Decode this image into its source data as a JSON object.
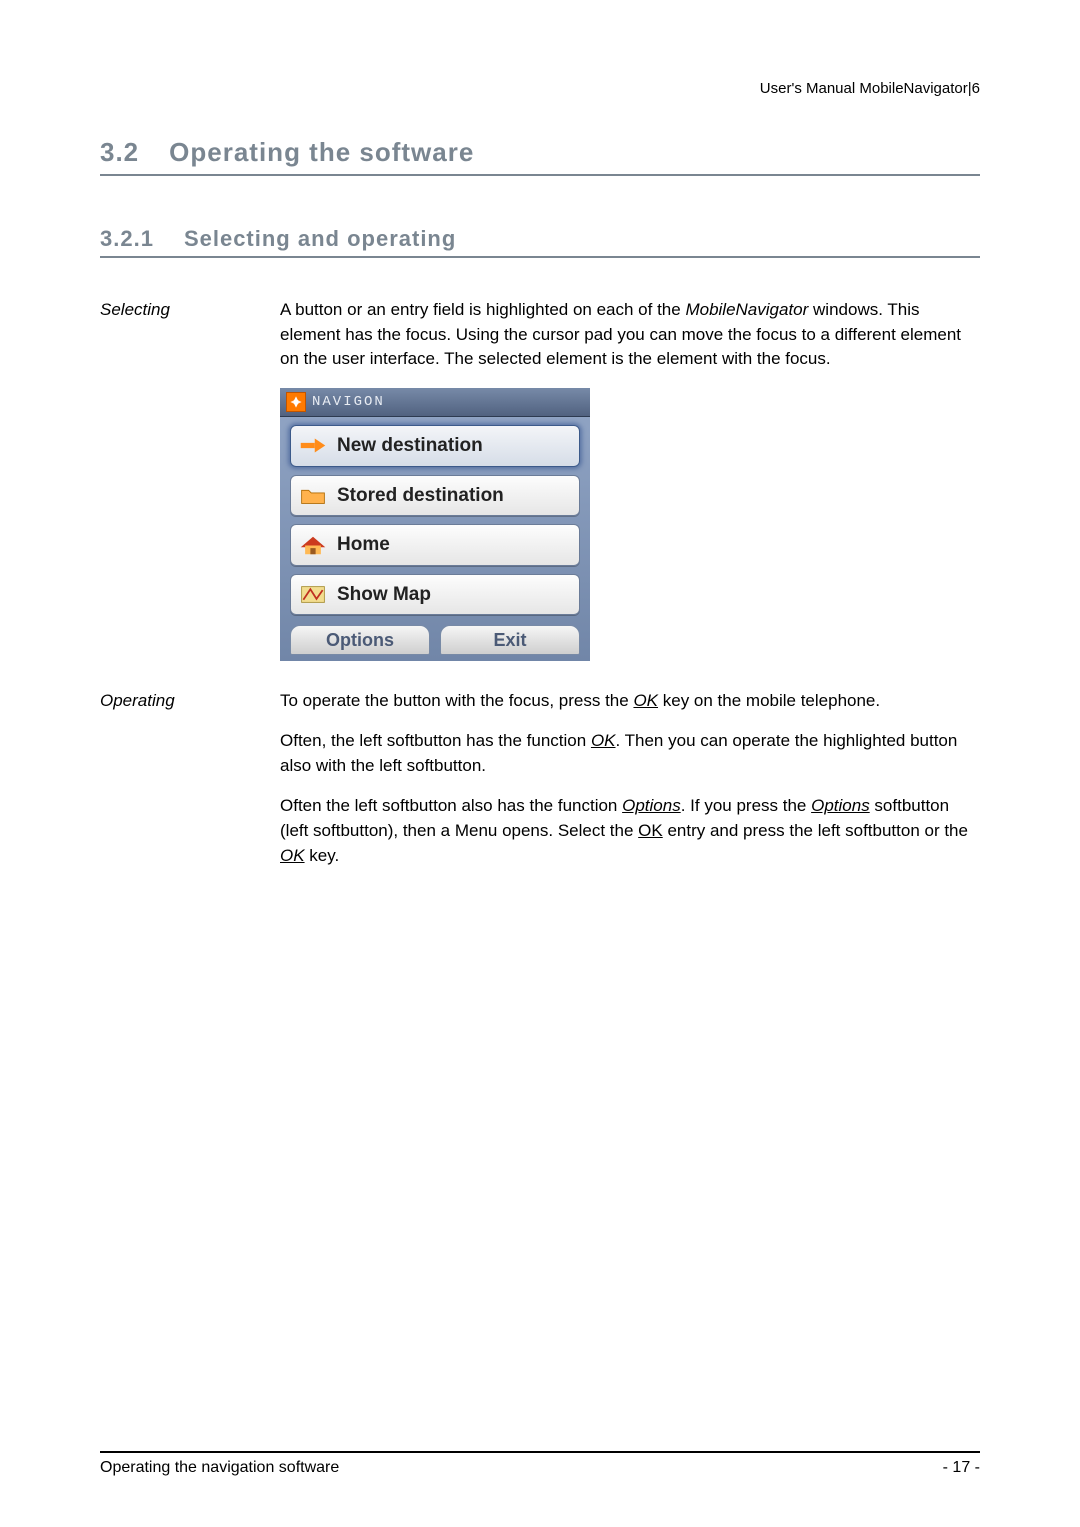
{
  "header": {
    "top_right": "User's Manual MobileNavigator|6"
  },
  "headings": {
    "h1_num": "3.2",
    "h1_title": "Operating the software",
    "h2_num": "3.2.1",
    "h2_title": "Selecting and operating"
  },
  "sidebar": {
    "selecting": "Selecting",
    "operating": "Operating"
  },
  "body": {
    "selecting_p1_a": "A button or an entry field is highlighted on each of the ",
    "selecting_p1_b": "MobileNavigator",
    "selecting_p1_c": " windows. This element has the focus. Using the cursor pad you can move the focus to a different element on the user interface. The selected element is the element with the focus.",
    "operating_p1_a": "To operate the button with the focus, press the ",
    "operating_p1_b": "OK",
    "operating_p1_c": " key on the mobile telephone.",
    "operating_p2_a": "Often, the left softbutton has the function ",
    "operating_p2_b": "OK",
    "operating_p2_c": ". Then you can operate the highlighted button also with the left softbutton.",
    "operating_p3_a": "Often the left softbutton also has the function ",
    "operating_p3_b": "Options",
    "operating_p3_c": ". If you press the ",
    "operating_p3_d": "Options",
    "operating_p3_e": " softbutton (left softbutton), then a Menu opens. Select the ",
    "operating_p3_f": "OK",
    "operating_p3_g": " entry and press the left softbutton or the ",
    "operating_p3_h": "OK",
    "operating_p3_i": " key."
  },
  "screenshot": {
    "brand": "NAVIGON",
    "items": [
      {
        "label": "New destination",
        "icon": "arrow-right-orange-icon",
        "focused": true
      },
      {
        "label": "Stored destination",
        "icon": "folder-orange-icon",
        "focused": false
      },
      {
        "label": "Home",
        "icon": "house-orange-icon",
        "focused": false
      },
      {
        "label": "Show Map",
        "icon": "map-icon",
        "focused": false
      }
    ],
    "soft_left": "Options",
    "soft_right": "Exit"
  },
  "footer": {
    "left": "Operating the navigation software",
    "right": "- 17 -"
  }
}
